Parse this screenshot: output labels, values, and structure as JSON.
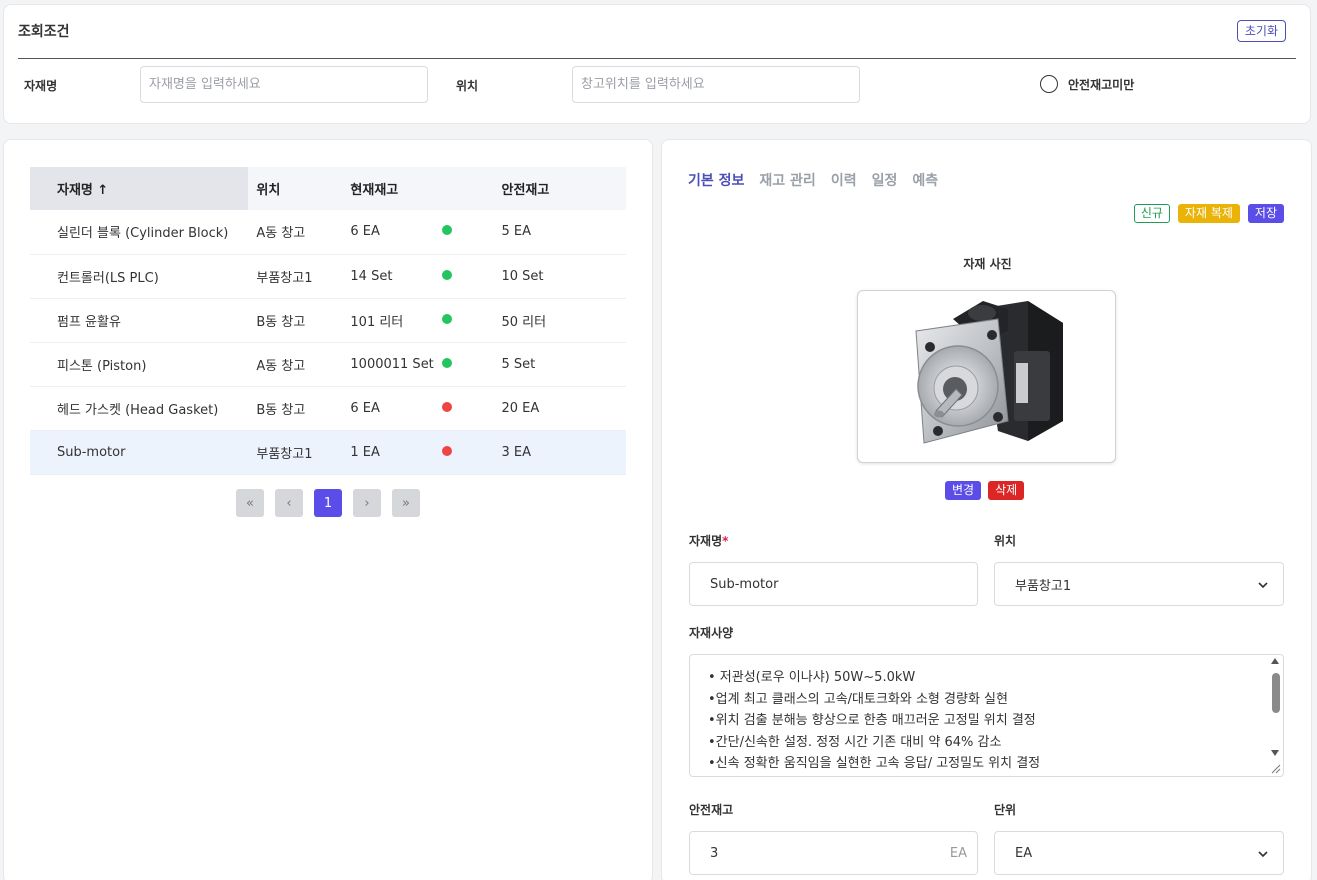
{
  "filter": {
    "title": "조회조건",
    "reset_label": "초기화",
    "name_label": "자재명",
    "name_placeholder": "자재명을 입력하세요",
    "location_label": "위치",
    "location_placeholder": "창고위치를 입력하세요",
    "below_safety_label": "안전재고미만"
  },
  "table": {
    "headers": [
      "자재명 ↑",
      "위치",
      "현재재고",
      "",
      "안전재고"
    ],
    "rows": [
      {
        "name": "실린더 블록 (Cylinder Block)",
        "location": "A동 창고",
        "stock": "6 EA",
        "status": "ok",
        "safety": "5 EA"
      },
      {
        "name": "컨트롤러(LS PLC)",
        "location": "부품창고1",
        "stock": "14 Set",
        "status": "ok",
        "safety": "10 Set"
      },
      {
        "name": "펌프 윤활유",
        "location": "B동 창고",
        "stock": "101 리터",
        "status": "ok",
        "safety": "50 리터"
      },
      {
        "name": "피스톤 (Piston)",
        "location": "A동 창고",
        "stock": "1000011 Set",
        "status": "ok",
        "safety": "5 Set"
      },
      {
        "name": "헤드 가스켓 (Head Gasket)",
        "location": "B동 창고",
        "stock": "6 EA",
        "status": "low",
        "safety": "20 EA"
      },
      {
        "name": "Sub-motor",
        "location": "부품창고1",
        "stock": "1 EA",
        "status": "low",
        "safety": "3 EA"
      }
    ]
  },
  "pager": {
    "first": "«",
    "prev": "‹",
    "current": "1",
    "next": "›",
    "last": "»"
  },
  "detail": {
    "tabs": [
      "기본 정보",
      "재고 관리",
      "이력",
      "일정",
      "예측"
    ],
    "new_label": "신규",
    "copy_label": "자재 복제",
    "save_label": "저장",
    "photo_label": "자재 사진",
    "edit_label": "변경",
    "delete_label": "삭제",
    "name_label": "자재명",
    "required_mark": "*",
    "name_value": "Sub-motor",
    "location_label": "위치",
    "location_value": "부품창고1",
    "spec_label": "자재사양",
    "spec_lines": [
      "• 저관성(로우 이나샤) 50W~5.0kW",
      "•업계 최고 클래스의 고속/대토크화와 소형 경량화 실현",
      "•위치 검출 분해능 향상으로 한층 매끄러운 고정밀 위치 결정",
      "•간단/신속한 설정. 정정 시간 기존 대비 약 64% 감소",
      "•신속 정확한 움직임을 실현한 고속 응답/ 고정밀도 위치 결정"
    ],
    "safety_label": "안전재고",
    "safety_value": "3",
    "safety_unit": "EA",
    "unit_label": "단위",
    "unit_value": "EA"
  },
  "colors": {
    "accent": "#5b4ee8",
    "ok": "#22c55e",
    "low": "#ef4444",
    "warning": "#eab308"
  }
}
